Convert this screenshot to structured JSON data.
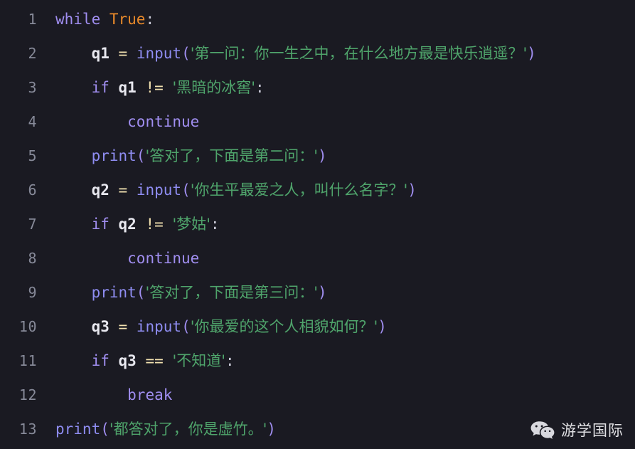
{
  "editor": {
    "background_color": "#1a1a22",
    "gutter_color": "#878a99",
    "language": "python",
    "total_lines": 13,
    "colors": {
      "keyword": "#a08ef0",
      "builtin": "#8f8df2",
      "constant": "#e8892a",
      "string": "#4fa46b",
      "operator": "#f3e2b0",
      "variable": "#e8e8ef",
      "punctuation": "#c9c9d6"
    }
  },
  "lines": [
    {
      "number": "1",
      "tokens": [
        {
          "t": "while",
          "c": "tok-keyword"
        },
        {
          "t": " ",
          "c": "tok-punct"
        },
        {
          "t": "True",
          "c": "tok-const"
        },
        {
          "t": ":",
          "c": "tok-punct"
        }
      ]
    },
    {
      "number": "2",
      "tokens": [
        {
          "t": "    ",
          "c": "tok-punct"
        },
        {
          "t": "q1",
          "c": "tok-var"
        },
        {
          "t": " ",
          "c": "tok-punct"
        },
        {
          "t": "=",
          "c": "tok-op"
        },
        {
          "t": " ",
          "c": "tok-punct"
        },
        {
          "t": "input",
          "c": "tok-builtin"
        },
        {
          "t": "(",
          "c": "tok-paren"
        },
        {
          "t": "'第一问：你一生之中，在什么地方最是快乐逍遥？'",
          "c": "tok-string cjk"
        },
        {
          "t": ")",
          "c": "tok-paren"
        }
      ]
    },
    {
      "number": "3",
      "tokens": [
        {
          "t": "    ",
          "c": "tok-punct"
        },
        {
          "t": "if",
          "c": "tok-keyword"
        },
        {
          "t": " ",
          "c": "tok-punct"
        },
        {
          "t": "q1",
          "c": "tok-var"
        },
        {
          "t": " ",
          "c": "tok-punct"
        },
        {
          "t": "!=",
          "c": "tok-op"
        },
        {
          "t": " ",
          "c": "tok-punct"
        },
        {
          "t": "'黑暗的冰窖'",
          "c": "tok-string cjk"
        },
        {
          "t": ":",
          "c": "tok-punct"
        }
      ]
    },
    {
      "number": "4",
      "tokens": [
        {
          "t": "        ",
          "c": "tok-punct"
        },
        {
          "t": "continue",
          "c": "tok-keyword"
        }
      ]
    },
    {
      "number": "5",
      "tokens": [
        {
          "t": "    ",
          "c": "tok-punct"
        },
        {
          "t": "print",
          "c": "tok-builtin"
        },
        {
          "t": "(",
          "c": "tok-paren"
        },
        {
          "t": "'答对了，下面是第二问：'",
          "c": "tok-string cjk"
        },
        {
          "t": ")",
          "c": "tok-paren"
        }
      ]
    },
    {
      "number": "6",
      "tokens": [
        {
          "t": "    ",
          "c": "tok-punct"
        },
        {
          "t": "q2",
          "c": "tok-var"
        },
        {
          "t": " ",
          "c": "tok-punct"
        },
        {
          "t": "=",
          "c": "tok-op"
        },
        {
          "t": " ",
          "c": "tok-punct"
        },
        {
          "t": "input",
          "c": "tok-builtin"
        },
        {
          "t": "(",
          "c": "tok-paren"
        },
        {
          "t": "'你生平最爱之人，叫什么名字？'",
          "c": "tok-string cjk"
        },
        {
          "t": ")",
          "c": "tok-paren"
        }
      ]
    },
    {
      "number": "7",
      "tokens": [
        {
          "t": "    ",
          "c": "tok-punct"
        },
        {
          "t": "if",
          "c": "tok-keyword"
        },
        {
          "t": " ",
          "c": "tok-punct"
        },
        {
          "t": "q2",
          "c": "tok-var"
        },
        {
          "t": " ",
          "c": "tok-punct"
        },
        {
          "t": "!=",
          "c": "tok-op"
        },
        {
          "t": " ",
          "c": "tok-punct"
        },
        {
          "t": "'梦姑'",
          "c": "tok-string cjk"
        },
        {
          "t": ":",
          "c": "tok-punct"
        }
      ]
    },
    {
      "number": "8",
      "tokens": [
        {
          "t": "        ",
          "c": "tok-punct"
        },
        {
          "t": "continue",
          "c": "tok-keyword"
        }
      ]
    },
    {
      "number": "9",
      "tokens": [
        {
          "t": "    ",
          "c": "tok-punct"
        },
        {
          "t": "print",
          "c": "tok-builtin"
        },
        {
          "t": "(",
          "c": "tok-paren"
        },
        {
          "t": "'答对了，下面是第三问：'",
          "c": "tok-string cjk"
        },
        {
          "t": ")",
          "c": "tok-paren"
        }
      ]
    },
    {
      "number": "10",
      "tokens": [
        {
          "t": "    ",
          "c": "tok-punct"
        },
        {
          "t": "q3",
          "c": "tok-var"
        },
        {
          "t": " ",
          "c": "tok-punct"
        },
        {
          "t": "=",
          "c": "tok-op"
        },
        {
          "t": " ",
          "c": "tok-punct"
        },
        {
          "t": "input",
          "c": "tok-builtin"
        },
        {
          "t": "(",
          "c": "tok-paren"
        },
        {
          "t": "'你最爱的这个人相貌如何？'",
          "c": "tok-string cjk"
        },
        {
          "t": ")",
          "c": "tok-paren"
        }
      ]
    },
    {
      "number": "11",
      "tokens": [
        {
          "t": "    ",
          "c": "tok-punct"
        },
        {
          "t": "if",
          "c": "tok-keyword"
        },
        {
          "t": " ",
          "c": "tok-punct"
        },
        {
          "t": "q3",
          "c": "tok-var"
        },
        {
          "t": " ",
          "c": "tok-punct"
        },
        {
          "t": "==",
          "c": "tok-op"
        },
        {
          "t": " ",
          "c": "tok-punct"
        },
        {
          "t": "'不知道'",
          "c": "tok-string cjk"
        },
        {
          "t": ":",
          "c": "tok-punct"
        }
      ]
    },
    {
      "number": "12",
      "tokens": [
        {
          "t": "        ",
          "c": "tok-punct"
        },
        {
          "t": "break",
          "c": "tok-keyword"
        }
      ]
    },
    {
      "number": "13",
      "tokens": [
        {
          "t": "print",
          "c": "tok-builtin"
        },
        {
          "t": "(",
          "c": "tok-paren"
        },
        {
          "t": "'都答对了，你是虚竹。'",
          "c": "tok-string cjk"
        },
        {
          "t": ")",
          "c": "tok-paren"
        }
      ]
    }
  ],
  "watermark": {
    "icon": "wechat-icon",
    "label": "游学国际",
    "text_color": "#f2f2f5"
  }
}
